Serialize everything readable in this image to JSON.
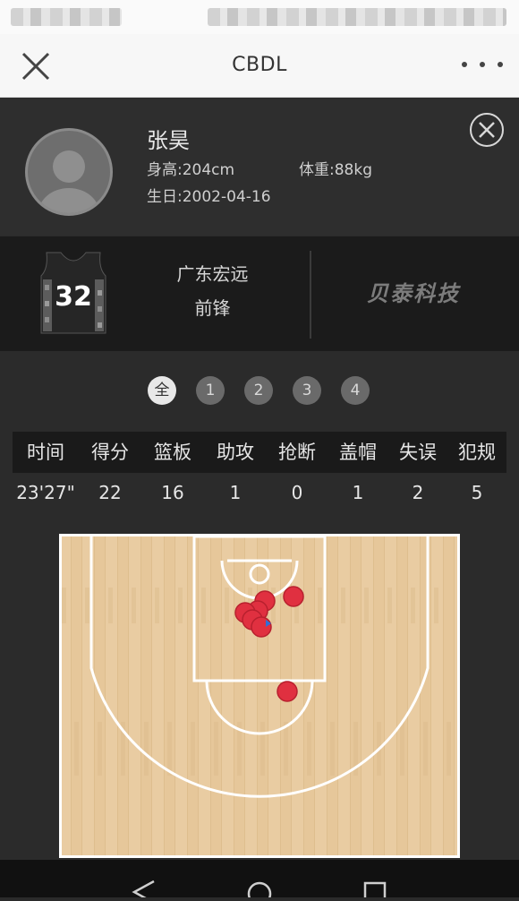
{
  "app": {
    "title": "CBDL"
  },
  "player": {
    "name": "张昊",
    "height_label": "身高:",
    "height": "204cm",
    "weight_label": "体重:",
    "weight": "88kg",
    "birthday_label": "生日:",
    "birthday": "2002-04-16"
  },
  "team": {
    "jersey_number": "32",
    "name": "广东宏远",
    "position": "前锋",
    "sponsor": "贝泰科技"
  },
  "quarters": [
    "全",
    "1",
    "2",
    "3",
    "4"
  ],
  "selected_quarter": "全",
  "stats": {
    "headers": [
      "时间",
      "得分",
      "篮板",
      "助攻",
      "抢断",
      "盖帽",
      "失误",
      "犯规"
    ],
    "values": [
      "23'27\"",
      "22",
      "16",
      "1",
      "0",
      "1",
      "2",
      "5"
    ]
  },
  "colors": {
    "shot_made": "#e03040",
    "court_wood": "#e6c79a",
    "accent_marker": "#2f6fd8"
  }
}
